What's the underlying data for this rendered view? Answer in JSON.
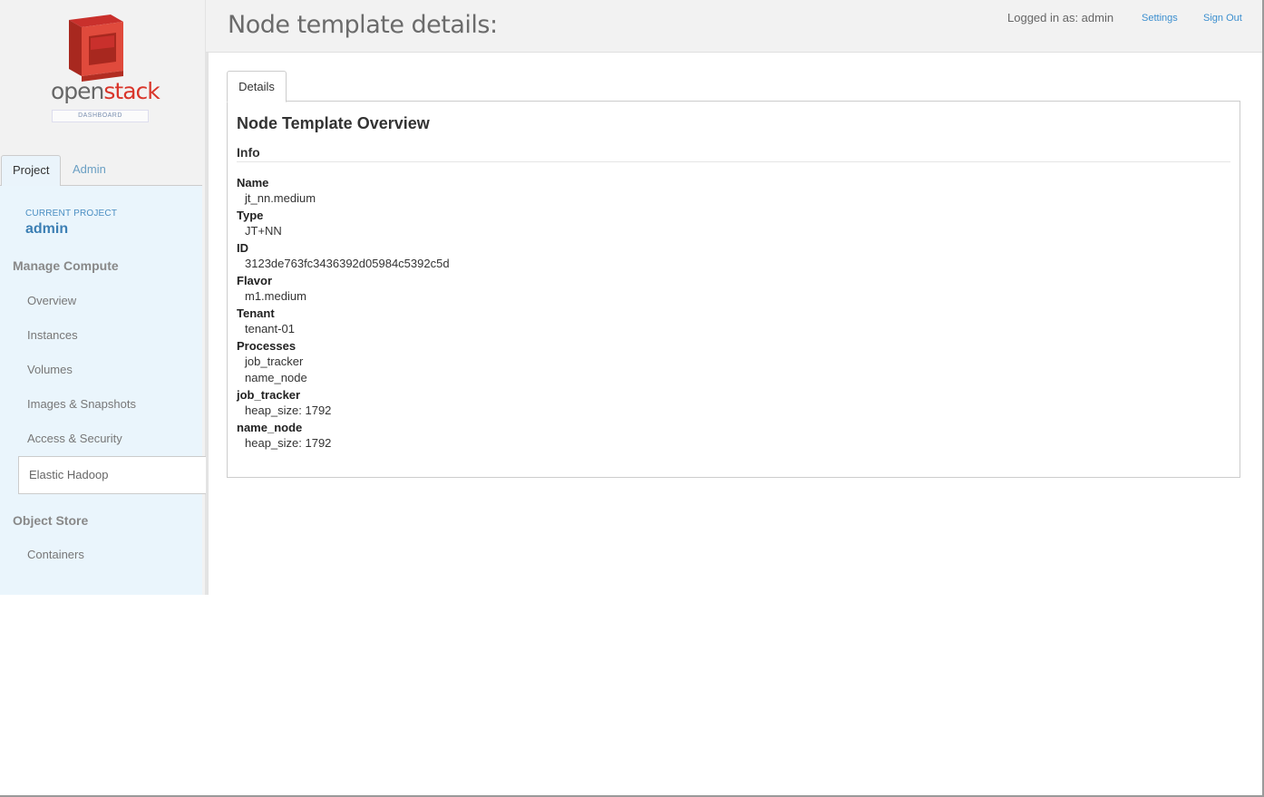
{
  "header": {
    "title": "Node template details:",
    "logged_in_text": "Logged in as: admin",
    "settings_label": "Settings",
    "signout_label": "Sign Out"
  },
  "brand": {
    "open": "open",
    "stack": "stack",
    "dashboard_label": "DASHBOARD",
    "accent": "#d9352a"
  },
  "sidebar": {
    "tabs": [
      {
        "label": "Project"
      },
      {
        "label": "Admin"
      }
    ],
    "current_project_label": "CURRENT PROJECT",
    "current_project_name": "admin",
    "sections": [
      {
        "heading": "Manage Compute",
        "items": [
          {
            "label": "Overview"
          },
          {
            "label": "Instances"
          },
          {
            "label": "Volumes"
          },
          {
            "label": "Images & Snapshots"
          },
          {
            "label": "Access & Security"
          },
          {
            "label": "Elastic Hadoop",
            "active": true
          }
        ]
      },
      {
        "heading": "Object Store",
        "items": [
          {
            "label": "Containers"
          }
        ]
      }
    ]
  },
  "main": {
    "tab_label": "Details",
    "overview_title": "Node Template Overview",
    "info_heading": "Info",
    "fields": [
      {
        "label": "Name",
        "values": [
          "jt_nn.medium"
        ]
      },
      {
        "label": "Type",
        "values": [
          "JT+NN"
        ]
      },
      {
        "label": "ID",
        "values": [
          "3123de763fc3436392d05984c5392c5d"
        ]
      },
      {
        "label": "Flavor",
        "values": [
          "m1.medium"
        ]
      },
      {
        "label": "Tenant",
        "values": [
          "tenant-01"
        ]
      },
      {
        "label": "Processes",
        "values": [
          "job_tracker",
          "name_node"
        ]
      },
      {
        "label": "job_tracker",
        "values": [
          "heap_size: 1792"
        ]
      },
      {
        "label": "name_node",
        "values": [
          "heap_size: 1792"
        ]
      }
    ]
  },
  "colors": {
    "link": "#3c8fcf",
    "sidebar_bg": "#eaf5fc",
    "header_bg": "#f2f2f2"
  }
}
